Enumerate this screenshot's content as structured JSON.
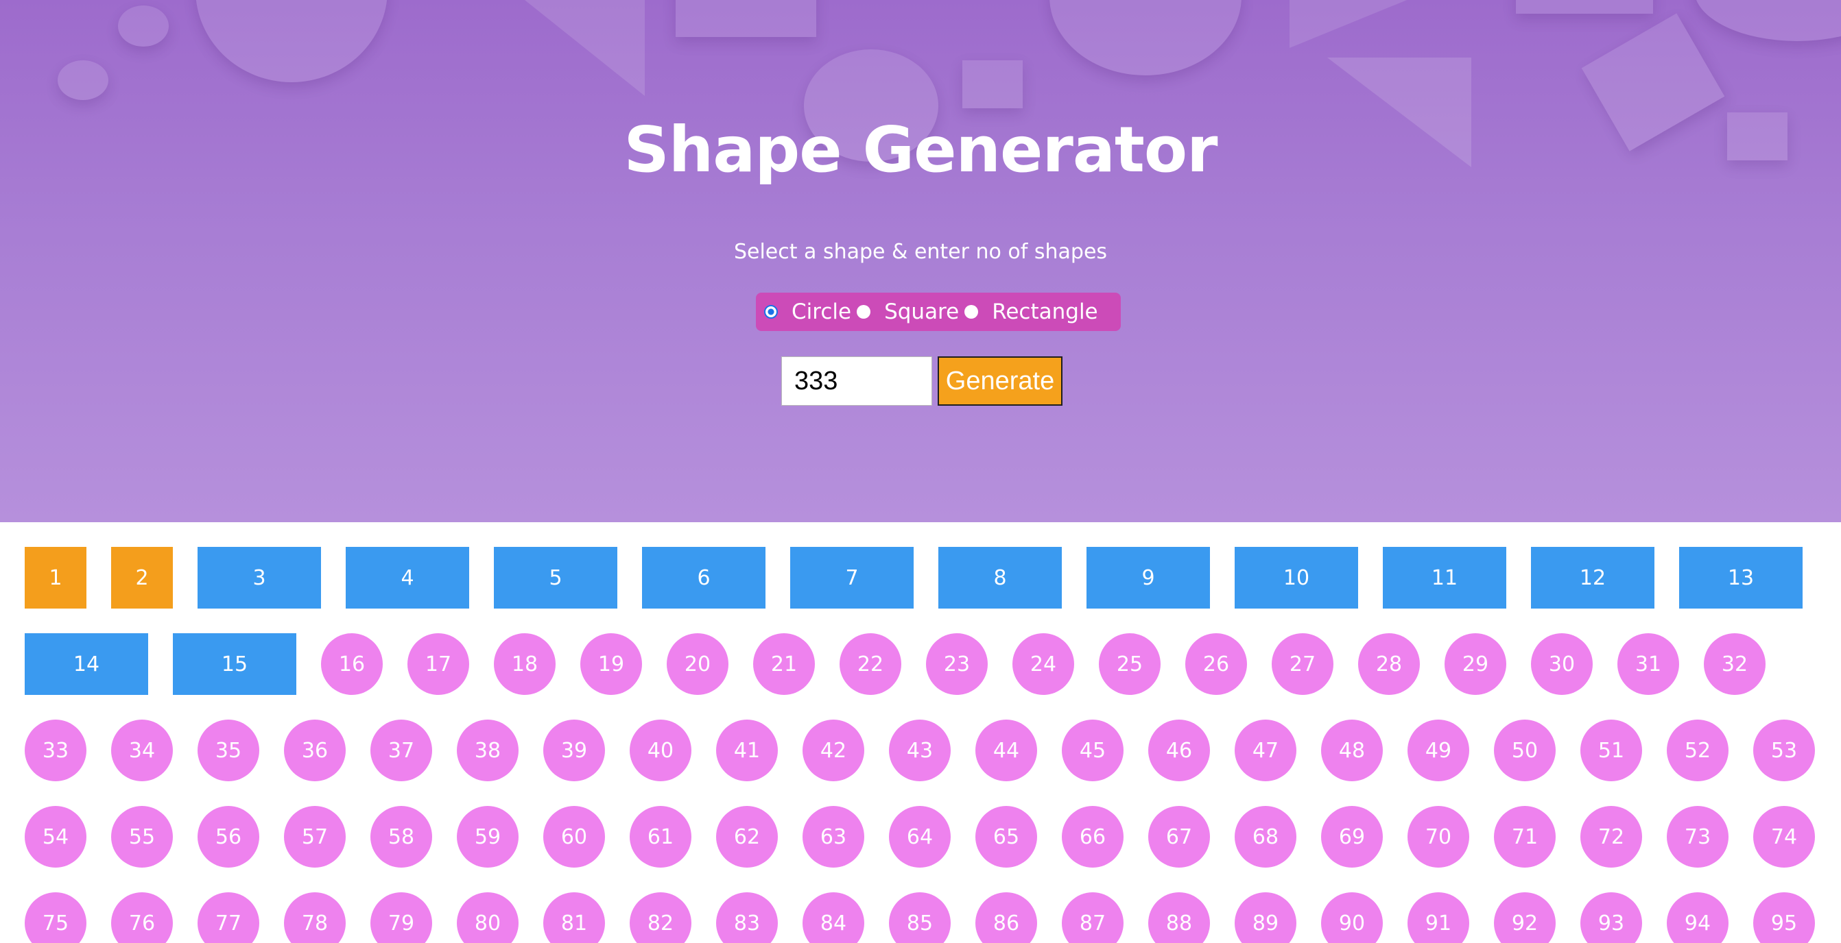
{
  "header": {
    "title": "Shape Generator",
    "subtitle": "Select a shape & enter no of shapes"
  },
  "shape_options": [
    {
      "label": "Circle",
      "selected": true
    },
    {
      "label": "Square",
      "selected": false
    },
    {
      "label": "Rectangle",
      "selected": false
    }
  ],
  "controls": {
    "count_value": "333",
    "generate_label": "Generate"
  },
  "colors": {
    "circle": "#ee82ee",
    "square": "#f49e1c",
    "rectangle": "#3a9af0",
    "radio_group_bg": "#cc4bb8",
    "button_bg": "#f5a11c"
  },
  "shapes": [
    {
      "label": "1",
      "type": "square"
    },
    {
      "label": "2",
      "type": "square"
    },
    {
      "label": "3",
      "type": "rect"
    },
    {
      "label": "4",
      "type": "rect"
    },
    {
      "label": "5",
      "type": "rect"
    },
    {
      "label": "6",
      "type": "rect"
    },
    {
      "label": "7",
      "type": "rect"
    },
    {
      "label": "8",
      "type": "rect"
    },
    {
      "label": "9",
      "type": "rect"
    },
    {
      "label": "10",
      "type": "rect"
    },
    {
      "label": "11",
      "type": "rect"
    },
    {
      "label": "12",
      "type": "rect"
    },
    {
      "label": "13",
      "type": "rect"
    },
    {
      "label": "14",
      "type": "rect"
    },
    {
      "label": "15",
      "type": "rect"
    },
    {
      "label": "16",
      "type": "circle"
    },
    {
      "label": "17",
      "type": "circle"
    },
    {
      "label": "18",
      "type": "circle"
    },
    {
      "label": "19",
      "type": "circle"
    },
    {
      "label": "20",
      "type": "circle"
    },
    {
      "label": "21",
      "type": "circle"
    },
    {
      "label": "22",
      "type": "circle"
    },
    {
      "label": "23",
      "type": "circle"
    },
    {
      "label": "24",
      "type": "circle"
    },
    {
      "label": "25",
      "type": "circle"
    },
    {
      "label": "26",
      "type": "circle"
    },
    {
      "label": "27",
      "type": "circle"
    },
    {
      "label": "28",
      "type": "circle"
    },
    {
      "label": "29",
      "type": "circle"
    },
    {
      "label": "30",
      "type": "circle"
    },
    {
      "label": "31",
      "type": "circle"
    },
    {
      "label": "32",
      "type": "circle"
    },
    {
      "label": "33",
      "type": "circle"
    },
    {
      "label": "34",
      "type": "circle"
    },
    {
      "label": "35",
      "type": "circle"
    },
    {
      "label": "36",
      "type": "circle"
    },
    {
      "label": "37",
      "type": "circle"
    },
    {
      "label": "38",
      "type": "circle"
    },
    {
      "label": "39",
      "type": "circle"
    },
    {
      "label": "40",
      "type": "circle"
    },
    {
      "label": "41",
      "type": "circle"
    },
    {
      "label": "42",
      "type": "circle"
    },
    {
      "label": "43",
      "type": "circle"
    },
    {
      "label": "44",
      "type": "circle"
    },
    {
      "label": "45",
      "type": "circle"
    },
    {
      "label": "46",
      "type": "circle"
    },
    {
      "label": "47",
      "type": "circle"
    },
    {
      "label": "48",
      "type": "circle"
    },
    {
      "label": "49",
      "type": "circle"
    },
    {
      "label": "50",
      "type": "circle"
    },
    {
      "label": "51",
      "type": "circle"
    },
    {
      "label": "52",
      "type": "circle"
    },
    {
      "label": "53",
      "type": "circle"
    },
    {
      "label": "54",
      "type": "circle"
    },
    {
      "label": "55",
      "type": "circle"
    },
    {
      "label": "56",
      "type": "circle"
    },
    {
      "label": "57",
      "type": "circle"
    },
    {
      "label": "58",
      "type": "circle"
    },
    {
      "label": "59",
      "type": "circle"
    },
    {
      "label": "60",
      "type": "circle"
    },
    {
      "label": "61",
      "type": "circle"
    },
    {
      "label": "62",
      "type": "circle"
    },
    {
      "label": "63",
      "type": "circle"
    },
    {
      "label": "64",
      "type": "circle"
    },
    {
      "label": "65",
      "type": "circle"
    },
    {
      "label": "66",
      "type": "circle"
    },
    {
      "label": "67",
      "type": "circle"
    },
    {
      "label": "68",
      "type": "circle"
    },
    {
      "label": "69",
      "type": "circle"
    },
    {
      "label": "70",
      "type": "circle"
    },
    {
      "label": "71",
      "type": "circle"
    },
    {
      "label": "72",
      "type": "circle"
    },
    {
      "label": "73",
      "type": "circle"
    },
    {
      "label": "74",
      "type": "circle"
    },
    {
      "label": "75",
      "type": "circle"
    },
    {
      "label": "76",
      "type": "circle"
    },
    {
      "label": "77",
      "type": "circle"
    },
    {
      "label": "78",
      "type": "circle"
    },
    {
      "label": "79",
      "type": "circle"
    },
    {
      "label": "80",
      "type": "circle"
    },
    {
      "label": "81",
      "type": "circle"
    },
    {
      "label": "82",
      "type": "circle"
    },
    {
      "label": "83",
      "type": "circle"
    },
    {
      "label": "84",
      "type": "circle"
    },
    {
      "label": "85",
      "type": "circle"
    },
    {
      "label": "86",
      "type": "circle"
    },
    {
      "label": "87",
      "type": "circle"
    },
    {
      "label": "88",
      "type": "circle"
    },
    {
      "label": "89",
      "type": "circle"
    },
    {
      "label": "90",
      "type": "circle"
    },
    {
      "label": "91",
      "type": "circle"
    },
    {
      "label": "92",
      "type": "circle"
    },
    {
      "label": "93",
      "type": "circle"
    },
    {
      "label": "94",
      "type": "circle"
    },
    {
      "label": "95",
      "type": "circle"
    }
  ]
}
